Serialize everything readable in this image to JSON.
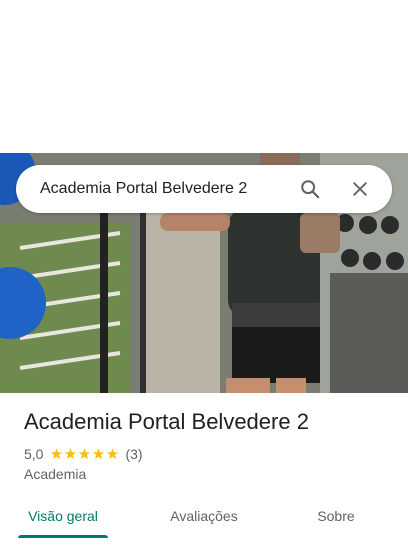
{
  "search": {
    "query": "Academia Portal Belvedere 2",
    "search_icon": "search-icon",
    "close_icon": "close-icon"
  },
  "place": {
    "title": "Academia Portal Belvedere 2",
    "rating": "5,0",
    "stars": 5,
    "review_count": "(3)",
    "category": "Academia",
    "star_color": "#fbbc04"
  },
  "tabs": [
    {
      "label": "Visão geral",
      "active": true
    },
    {
      "label": "Avaliações",
      "active": false
    },
    {
      "label": "Sobre",
      "active": false
    }
  ],
  "colors": {
    "accent": "#00796b",
    "secondary_text": "#5f6368"
  }
}
